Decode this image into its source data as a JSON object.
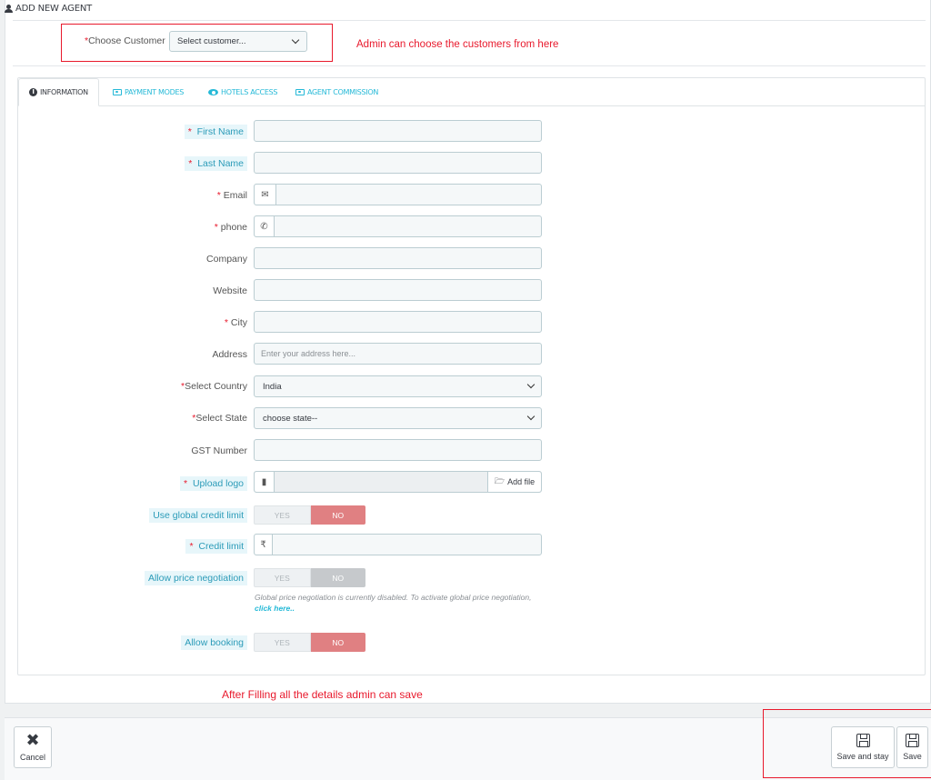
{
  "panel": {
    "title": "ADD NEW AGENT"
  },
  "customer": {
    "label": "Choose Customer",
    "required_mark": "*",
    "selected": "Select customer...",
    "annotation": "Admin can choose the customers from here"
  },
  "tabs": [
    {
      "label": "INFORMATION",
      "icon": "info-circle-icon",
      "active": true
    },
    {
      "label": "PAYMENT MODES",
      "icon": "money-icon",
      "active": false
    },
    {
      "label": "HOTELS ACCESS",
      "icon": "eye-icon",
      "active": false
    },
    {
      "label": "AGENT COMMISSION",
      "icon": "money-icon",
      "active": false
    }
  ],
  "form": {
    "first_name": {
      "label": "First Name",
      "required": "*"
    },
    "last_name": {
      "label": "Last Name",
      "required": "*"
    },
    "email": {
      "label": "Email",
      "required": "*",
      "icon": "envelope-icon"
    },
    "phone": {
      "label": "phone",
      "required": "*",
      "icon": "phone-icon"
    },
    "company": {
      "label": "Company"
    },
    "website": {
      "label": "Website"
    },
    "city": {
      "label": "City",
      "required": "*"
    },
    "address": {
      "label": "Address",
      "placeholder": "Enter your address here..."
    },
    "country": {
      "label": "Select Country",
      "required": "*",
      "selected": "India"
    },
    "state": {
      "label": "Select State",
      "required": "*",
      "selected": "choose state--"
    },
    "gst": {
      "label": "GST Number"
    },
    "logo": {
      "label": "Upload logo",
      "required": "*",
      "button": "Add file"
    },
    "global_credit": {
      "label": "Use global credit limit",
      "yes": "YES",
      "no": "NO",
      "value": "NO"
    },
    "credit_limit": {
      "label": "Credit limit",
      "required": "*",
      "currency": "₹"
    },
    "price_negotiation": {
      "label": "Allow price negotiation",
      "yes": "YES",
      "no": "NO",
      "value": "NO",
      "help": "Global price negotiation is currently disabled. To activate global price negotiation,",
      "help_link": "click here.."
    },
    "booking": {
      "label": "Allow booking",
      "yes": "YES",
      "no": "NO",
      "value": "NO"
    }
  },
  "save_annotation": "After Filling all the details admin can save",
  "footer": {
    "cancel": "Cancel",
    "save_and_stay": "Save and stay",
    "save": "Save"
  },
  "colors": {
    "annotation_red": "#e8192c",
    "accent": "#25b9d7",
    "toggle_no": "#e08082"
  }
}
